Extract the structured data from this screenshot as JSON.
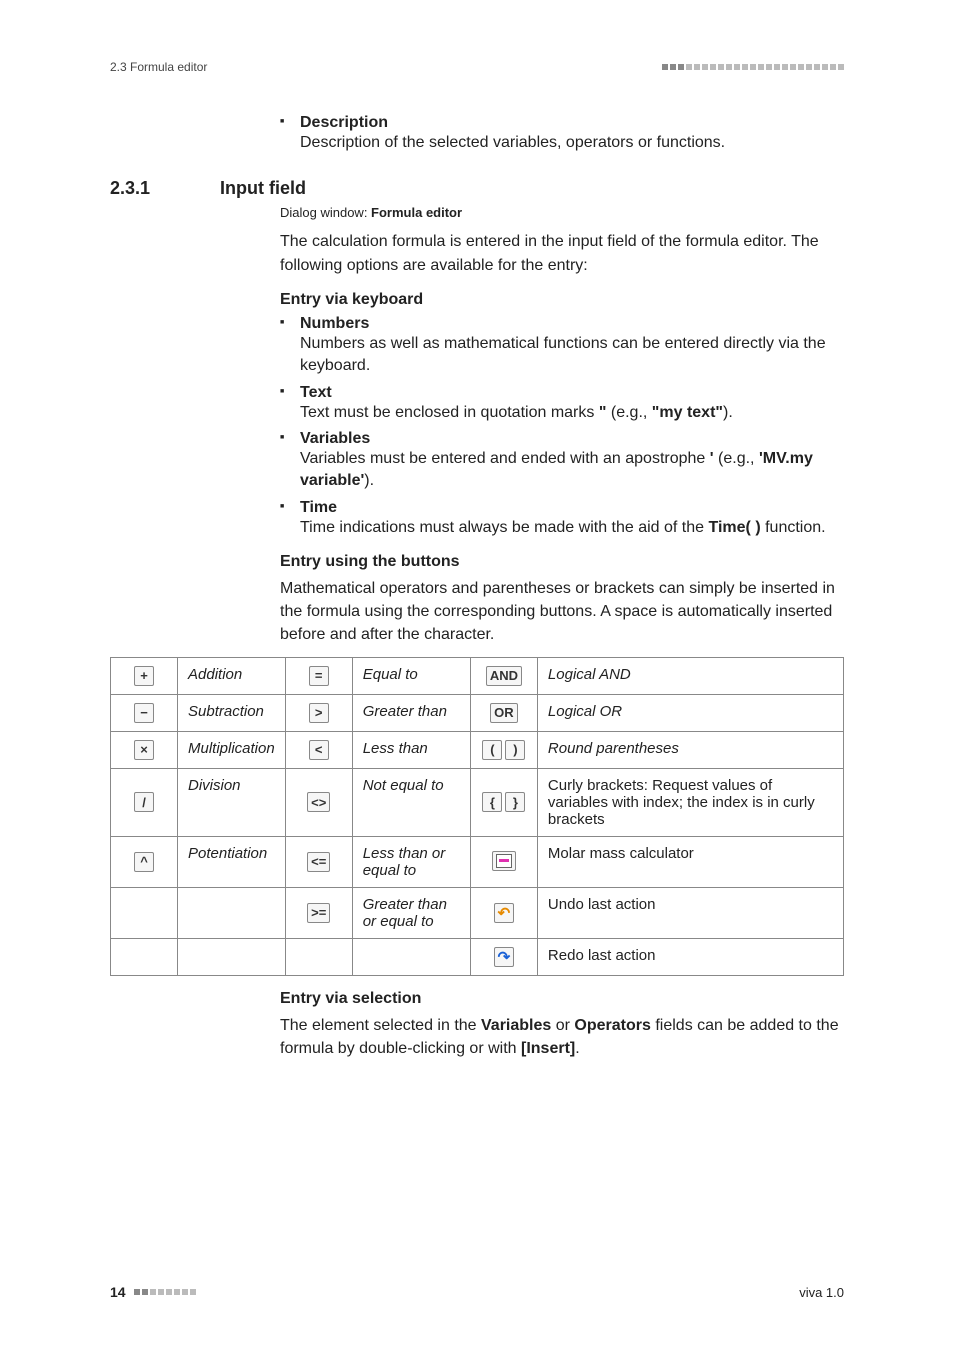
{
  "header": {
    "left": "2.3 Formula editor"
  },
  "intro_bullet": {
    "head": "Description",
    "desc": "Description of the selected variables, operators or functions."
  },
  "section": {
    "num": "2.3.1",
    "title": "Input field",
    "dialog_prefix": "Dialog window: ",
    "dialog_name": "Formula editor",
    "para": "The calculation formula is entered in the input field of the formula editor. The following options are available for the entry:"
  },
  "keyboard": {
    "heading": "Entry via keyboard",
    "items": [
      {
        "head": "Numbers",
        "desc": "Numbers as well as mathematical functions can be entered directly via the keyboard."
      },
      {
        "head": "Text",
        "desc_pre": "Text must be enclosed in quotation marks ",
        "q1": "\"",
        "mid": " (e.g., ",
        "example": "\"my text\"",
        "desc_post": ")."
      },
      {
        "head": "Variables",
        "desc_pre": "Variables must be entered and ended with an apostrophe ",
        "q1": "'",
        "mid": " (e.g., ",
        "example": "'MV.my variable'",
        "desc_post": ")."
      },
      {
        "head": "Time",
        "desc_pre": "Time indications must always be made with the aid of the ",
        "fn": "Time( )",
        "desc_post": " function."
      }
    ]
  },
  "buttons_section": {
    "heading": "Entry using the buttons",
    "para": "Mathematical operators and parentheses or brackets can simply be inserted in the formula using the corresponding buttons. A space is automatically inserted before and after the character."
  },
  "table": {
    "rows": [
      {
        "c1_sym": "+",
        "c1_label": "Addition",
        "c2_sym": "=",
        "c2_label": "Equal to",
        "c3_sym": "AND",
        "c3_label": "Logical AND"
      },
      {
        "c1_sym": "−",
        "c1_label": "Subtraction",
        "c2_sym": ">",
        "c2_label": "Greater than",
        "c3_sym": "OR",
        "c3_label": "Logical OR"
      },
      {
        "c1_sym": "×",
        "c1_label": "Multiplication",
        "c2_sym": "<",
        "c2_label": "Less than",
        "c3_sym": "()",
        "c3_label": "Round parentheses"
      },
      {
        "c1_sym": "/",
        "c1_label": "Division",
        "c2_sym": "<>",
        "c2_label": "Not equal to",
        "c3_sym": "{}",
        "c3_label": "Curly brackets: Request values of variables with index; the index is in curly brackets"
      },
      {
        "c1_sym": "^",
        "c1_label": "Potentiation",
        "c2_sym": "<=",
        "c2_label": "Less than or equal to",
        "c3_sym": "mm",
        "c3_label": "Molar mass calculator"
      },
      {
        "c1_sym": "",
        "c1_label": "",
        "c2_sym": ">=",
        "c2_label": "Greater than or equal to",
        "c3_sym": "undo",
        "c3_label": "Undo last action"
      },
      {
        "c1_sym": "",
        "c1_label": "",
        "c2_sym": "",
        "c2_label": "",
        "c3_sym": "redo",
        "c3_label": "Redo last action"
      }
    ]
  },
  "selection": {
    "heading": "Entry via selection",
    "pre": "The element selected in the ",
    "v": "Variables",
    "or": " or ",
    "op": "Operators",
    "mid": " fields can be added to the formula by double-clicking or with ",
    "ins": "[Insert]",
    "post": "."
  },
  "footer": {
    "page": "14",
    "right": "viva 1.0"
  }
}
